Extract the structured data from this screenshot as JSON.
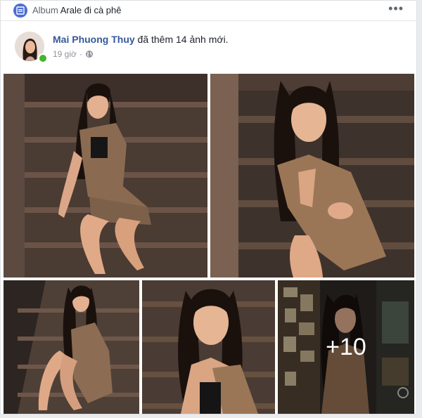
{
  "album": {
    "prefix": "Album",
    "name": "Arale đi cà phê",
    "more": "•••"
  },
  "post": {
    "author": "Mai Phuong Thuy",
    "action": "đã thêm 14 ảnh mới.",
    "time": "19 giờ",
    "separator": "·"
  },
  "photos": {
    "more_count": "+10"
  },
  "colors": {
    "link": "#365899",
    "online": "#42b72a",
    "album_icon": "#4c6ed2"
  }
}
